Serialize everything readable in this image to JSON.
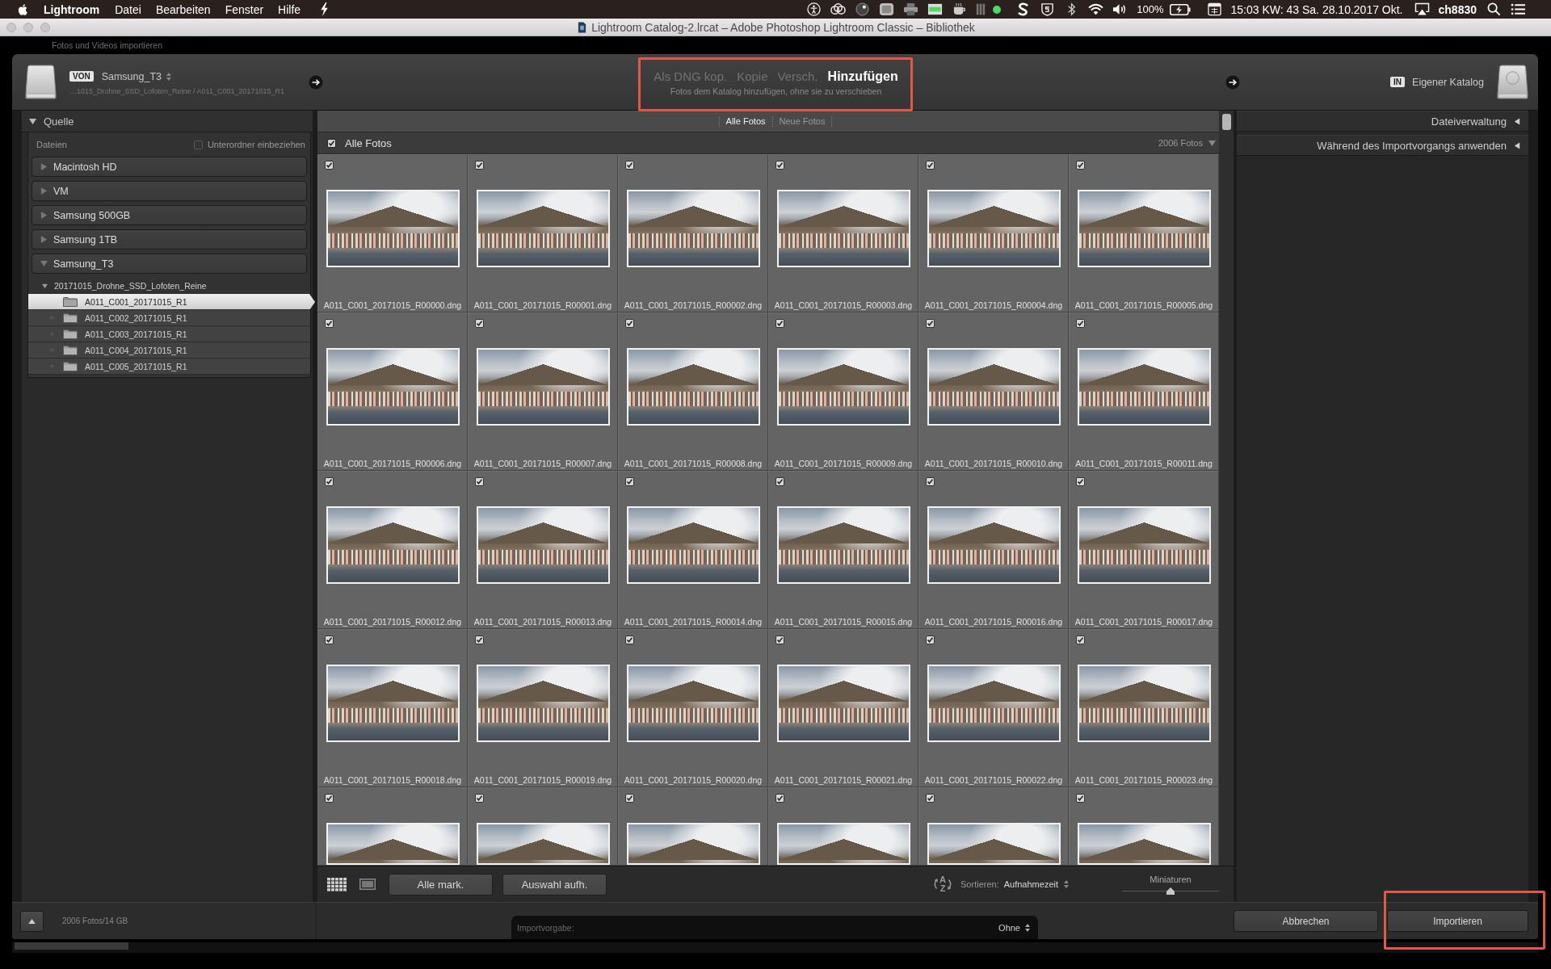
{
  "menu_bar": {
    "app_name": "Lightroom",
    "menus": [
      "Datei",
      "Bearbeiten",
      "Fenster",
      "Hilfe"
    ],
    "battery": "100%",
    "clock": "15:03 KW: 43 Sa. 28.10.2017 Okt.",
    "user": "ch8830"
  },
  "window": {
    "title": "Lightroom Catalog-2.lrcat – Adobe Photoshop Lightroom Classic – Bibliothek",
    "background_title": "Fotos und Videos importieren"
  },
  "import_header": {
    "source_badge": "VON",
    "source_name": "Samsung_T3",
    "source_path": "…1015_Drohne_SSD_Lofoten_Reine / A011_C001_20171015_R1",
    "modes": [
      {
        "label": "Als DNG kop.",
        "selected": false
      },
      {
        "label": "Kopie",
        "selected": false
      },
      {
        "label": "Versch.",
        "selected": false
      },
      {
        "label": "Hinzufügen",
        "selected": true
      }
    ],
    "mode_description": "Fotos dem Katalog hinzufügen, ohne sie zu verschieben",
    "destination_badge": "IN",
    "destination_name": "Eigener Katalog"
  },
  "source_panel": {
    "title": "Quelle",
    "expanded": true,
    "files_label": "Dateien",
    "include_subfolders": {
      "label": "Unterordner einbeziehen",
      "checked": false
    },
    "volumes": [
      {
        "name": "Macintosh HD",
        "expanded": false
      },
      {
        "name": "VM",
        "expanded": false
      },
      {
        "name": "Samsung 500GB",
        "expanded": false
      },
      {
        "name": "Samsung 1TB",
        "expanded": false
      },
      {
        "name": "Samsung_T3",
        "expanded": true,
        "children": [
          {
            "name": "20171015_Drohne_SSD_Lofoten_Reine",
            "expanded": true,
            "children": [
              {
                "name": "A011_C001_20171015_R1",
                "selected": true
              },
              {
                "name": "A011_C002_20171015_R1",
                "selected": false
              },
              {
                "name": "A011_C003_20171015_R1",
                "selected": false
              },
              {
                "name": "A011_C004_20171015_R1",
                "selected": false
              },
              {
                "name": "A011_C005_20171015_R1",
                "selected": false
              }
            ]
          }
        ]
      }
    ]
  },
  "grid": {
    "tabs": [
      {
        "label": "Alle Fotos",
        "selected": true
      },
      {
        "label": "Neue Fotos",
        "selected": false
      }
    ],
    "header": {
      "checked": true,
      "label": "Alle Fotos",
      "count": "2006 Fotos"
    },
    "photos": [
      {
        "name": "A011_C001_20171015_R00000.dng",
        "checked": true
      },
      {
        "name": "A011_C001_20171015_R00001.dng",
        "checked": true
      },
      {
        "name": "A011_C001_20171015_R00002.dng",
        "checked": true
      },
      {
        "name": "A011_C001_20171015_R00003.dng",
        "checked": true
      },
      {
        "name": "A011_C001_20171015_R00004.dng",
        "checked": true
      },
      {
        "name": "A011_C001_20171015_R00005.dng",
        "checked": true
      },
      {
        "name": "A011_C001_20171015_R00006.dng",
        "checked": true
      },
      {
        "name": "A011_C001_20171015_R00007.dng",
        "checked": true
      },
      {
        "name": "A011_C001_20171015_R00008.dng",
        "checked": true
      },
      {
        "name": "A011_C001_20171015_R00009.dng",
        "checked": true
      },
      {
        "name": "A011_C001_20171015_R00010.dng",
        "checked": true
      },
      {
        "name": "A011_C001_20171015_R00011.dng",
        "checked": true
      },
      {
        "name": "A011_C001_20171015_R00012.dng",
        "checked": true
      },
      {
        "name": "A011_C001_20171015_R00013.dng",
        "checked": true
      },
      {
        "name": "A011_C001_20171015_R00014.dng",
        "checked": true
      },
      {
        "name": "A011_C001_20171015_R00015.dng",
        "checked": true
      },
      {
        "name": "A011_C001_20171015_R00016.dng",
        "checked": true
      },
      {
        "name": "A011_C001_20171015_R00017.dng",
        "checked": true
      },
      {
        "name": "A011_C001_20171015_R00018.dng",
        "checked": true
      },
      {
        "name": "A011_C001_20171015_R00019.dng",
        "checked": true
      },
      {
        "name": "A011_C001_20171015_R00020.dng",
        "checked": true
      },
      {
        "name": "A011_C001_20171015_R00021.dng",
        "checked": true
      },
      {
        "name": "A011_C001_20171015_R00022.dng",
        "checked": true
      },
      {
        "name": "A011_C001_20171015_R00023.dng",
        "checked": true
      },
      {
        "checked": true
      },
      {
        "checked": true
      },
      {
        "checked": true
      },
      {
        "checked": true
      },
      {
        "checked": true
      },
      {
        "checked": true
      }
    ],
    "toolbar": {
      "views": [
        {
          "kind": "grid",
          "selected": true
        },
        {
          "kind": "loupe",
          "selected": false
        }
      ],
      "buttons": [
        "Alle mark.",
        "Auswahl aufh."
      ],
      "sort_letters": [
        "A",
        "Z"
      ],
      "sort_label": "Sortieren:",
      "sort_value": "Aufnahmezeit",
      "thumbnail_label": "Miniaturen",
      "thumbnail_size": {
        "level": 0.5
      }
    }
  },
  "right_panel": {
    "sections": [
      {
        "title": "Dateiverwaltung",
        "expanded": false
      },
      {
        "title": "Während des Importvorgangs anwenden",
        "expanded": false
      }
    ]
  },
  "bottom_bar": {
    "summary": "2006 Fotos/14 GB",
    "preset_label": "Importvorgabe:",
    "preset_value": "Ohne",
    "cancel": "Abbrechen",
    "import": "Importieren"
  }
}
